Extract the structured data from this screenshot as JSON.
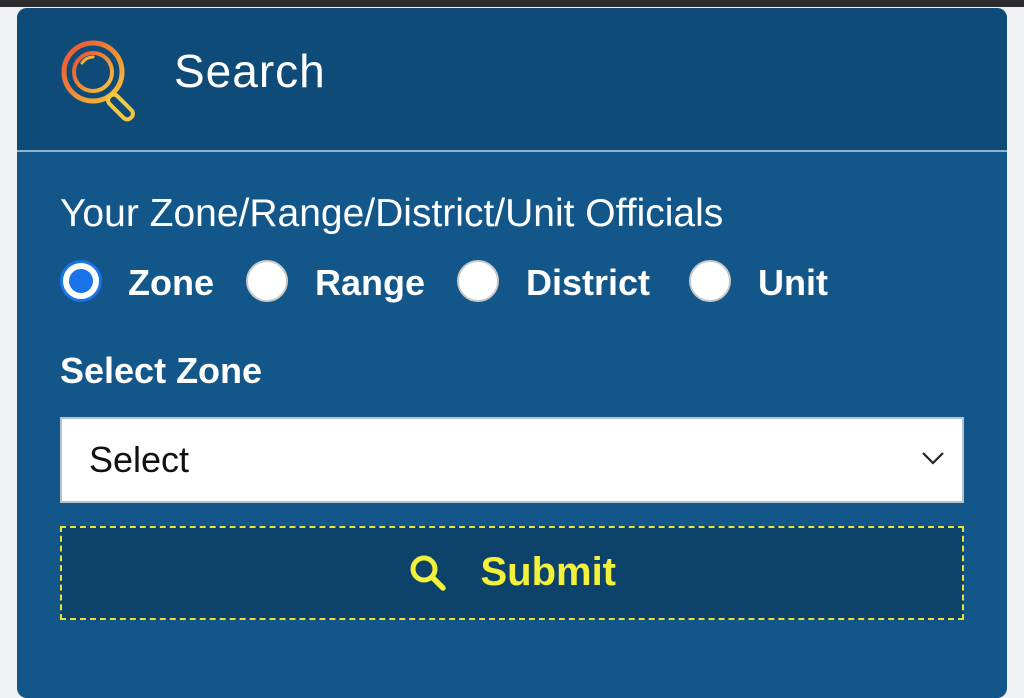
{
  "header": {
    "title": "Search",
    "icon": "magnifier-icon"
  },
  "form": {
    "officials_label": "Your Zone/Range/District/Unit Officials",
    "radio_options": [
      {
        "label": "Zone",
        "checked": true
      },
      {
        "label": "Range",
        "checked": false
      },
      {
        "label": "District",
        "checked": false
      },
      {
        "label": "Unit",
        "checked": false
      }
    ],
    "select_label": "Select Zone",
    "select_value": "Select",
    "submit_label": "Submit"
  },
  "colors": {
    "card_bg": "#12568a",
    "header_bg": "#0f4b78",
    "radio_accent": "#1a73e8",
    "submit_text": "#f4f13b",
    "submit_border": "#e6e33a"
  }
}
